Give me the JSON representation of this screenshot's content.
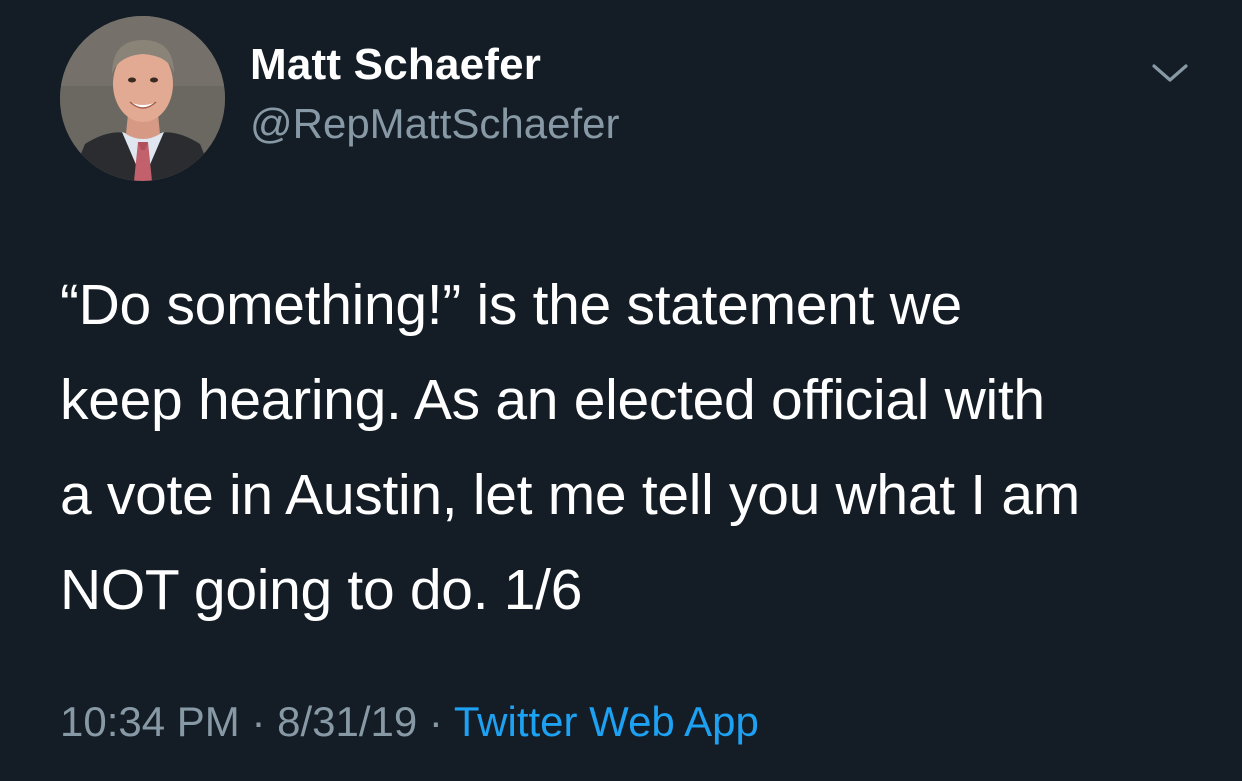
{
  "tweet": {
    "author": {
      "name": "Matt Schaefer",
      "handle": "@RepMattSchaefer"
    },
    "text_lines": [
      "“Do something!” is the statement we",
      "keep hearing. As an elected official with",
      "a vote in Austin, let me tell you what I am",
      "NOT going to do. 1/6"
    ],
    "time": "10:34 PM",
    "separator": " · ",
    "date": "8/31/19",
    "source": "Twitter Web App",
    "menu_icon": "chevron-down-icon"
  },
  "colors": {
    "background": "#141d26",
    "primary_text": "#ffffff",
    "secondary_text": "#8899a6",
    "link": "#1da1f2"
  }
}
